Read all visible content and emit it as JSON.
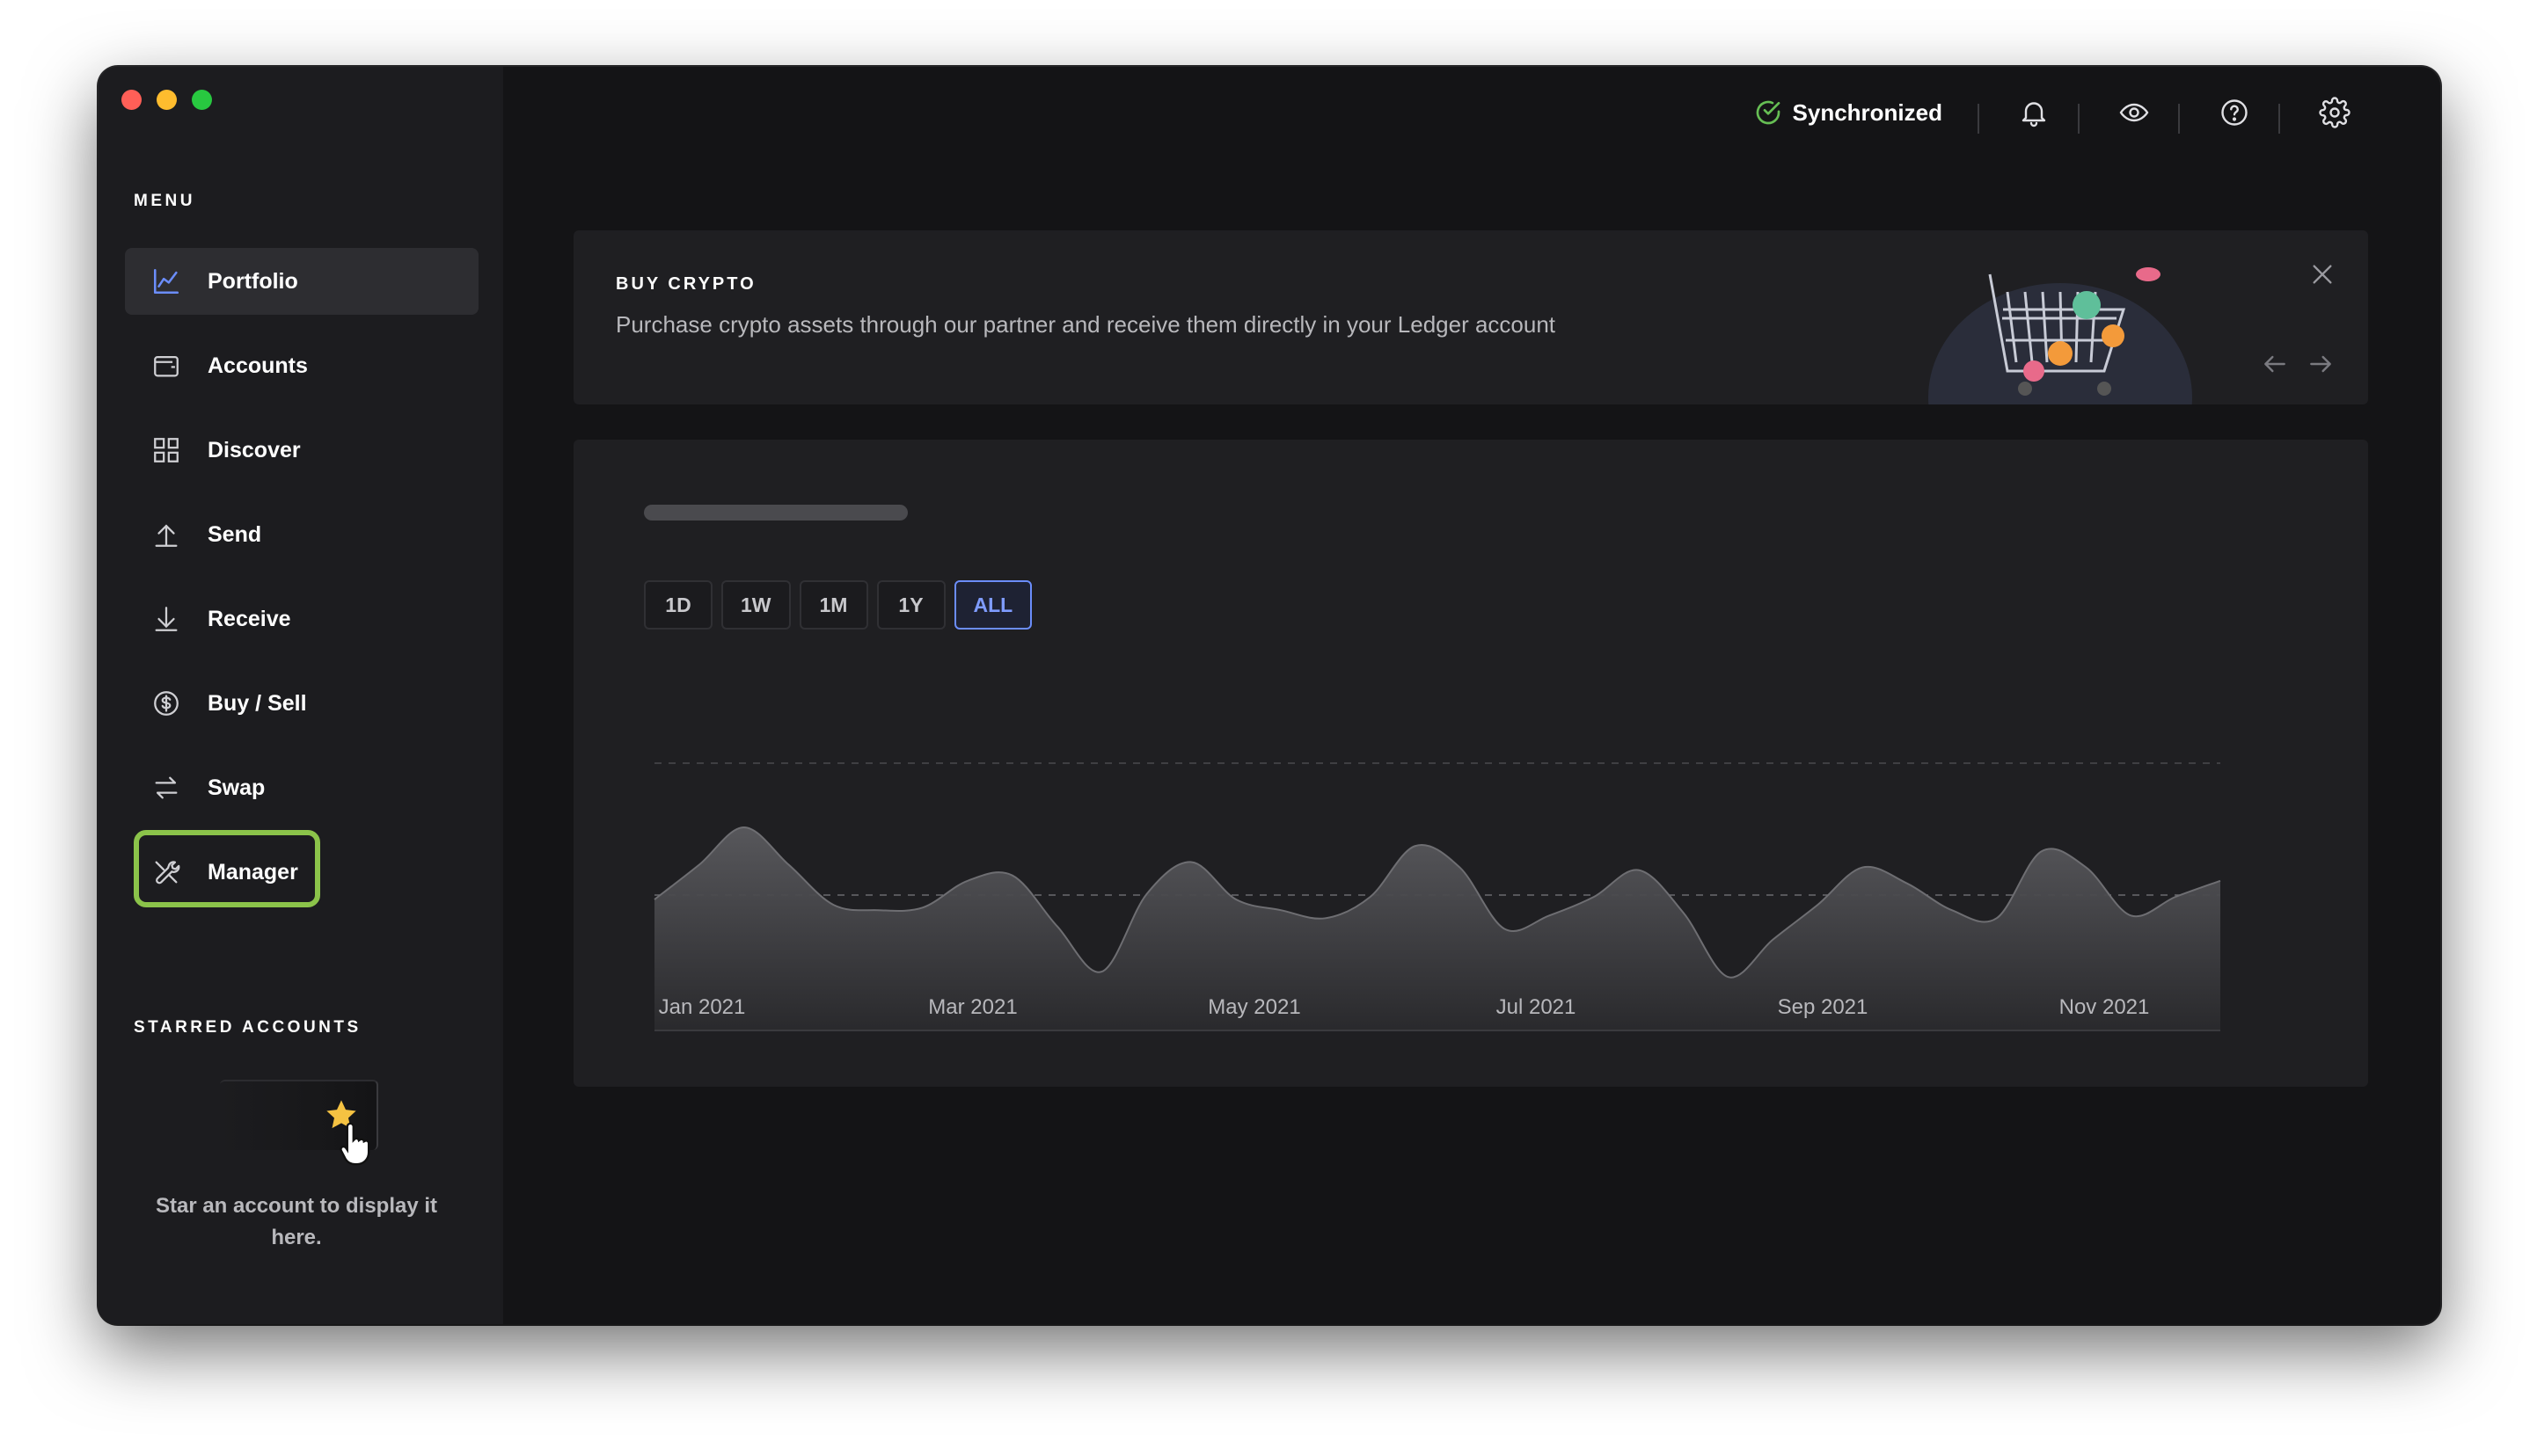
{
  "sidebar": {
    "menu_title": "MENU",
    "items": [
      {
        "label": "Portfolio",
        "icon": "chart-icon",
        "active": true
      },
      {
        "label": "Accounts",
        "icon": "wallet-icon"
      },
      {
        "label": "Discover",
        "icon": "grid-icon"
      },
      {
        "label": "Send",
        "icon": "upload-arrow-icon"
      },
      {
        "label": "Receive",
        "icon": "download-arrow-icon"
      },
      {
        "label": "Buy / Sell",
        "icon": "dollar-circle-icon"
      },
      {
        "label": "Swap",
        "icon": "swap-icon"
      },
      {
        "label": "Manager",
        "icon": "tools-icon",
        "highlighted": true
      }
    ],
    "starred_title": "STARRED ACCOUNTS",
    "starred_empty_text": "Star an account to display it here."
  },
  "topbar": {
    "sync_status": "Synchronized",
    "icons": [
      "bell-icon",
      "eye-icon",
      "help-icon",
      "settings-icon"
    ],
    "sync_color": "#66be54"
  },
  "banner": {
    "title": "BUY CRYPTO",
    "text": "Purchase crypto assets through our partner and receive them directly in your Ledger account"
  },
  "chart": {
    "ranges": [
      "1D",
      "1W",
      "1M",
      "1Y",
      "ALL"
    ],
    "active_range": "ALL",
    "accent": "#6b8dfa"
  },
  "chart_data": {
    "type": "area",
    "x_tick_labels": [
      "Jan 2021",
      "Mar 2021",
      "May 2021",
      "Jul 2021",
      "Sep 2021",
      "Nov 2021"
    ],
    "series": [
      {
        "values": [
          0.49,
          0.62,
          0.76,
          0.62,
          0.47,
          0.45,
          0.46,
          0.56,
          0.58,
          0.39,
          0.22,
          0.51,
          0.63,
          0.49,
          0.45,
          0.42,
          0.5,
          0.69,
          0.61,
          0.38,
          0.43,
          0.5,
          0.6,
          0.44,
          0.2,
          0.34,
          0.47,
          0.61,
          0.55,
          0.45,
          0.42,
          0.67,
          0.61,
          0.43,
          0.5,
          0.56
        ]
      }
    ],
    "grid": true
  }
}
